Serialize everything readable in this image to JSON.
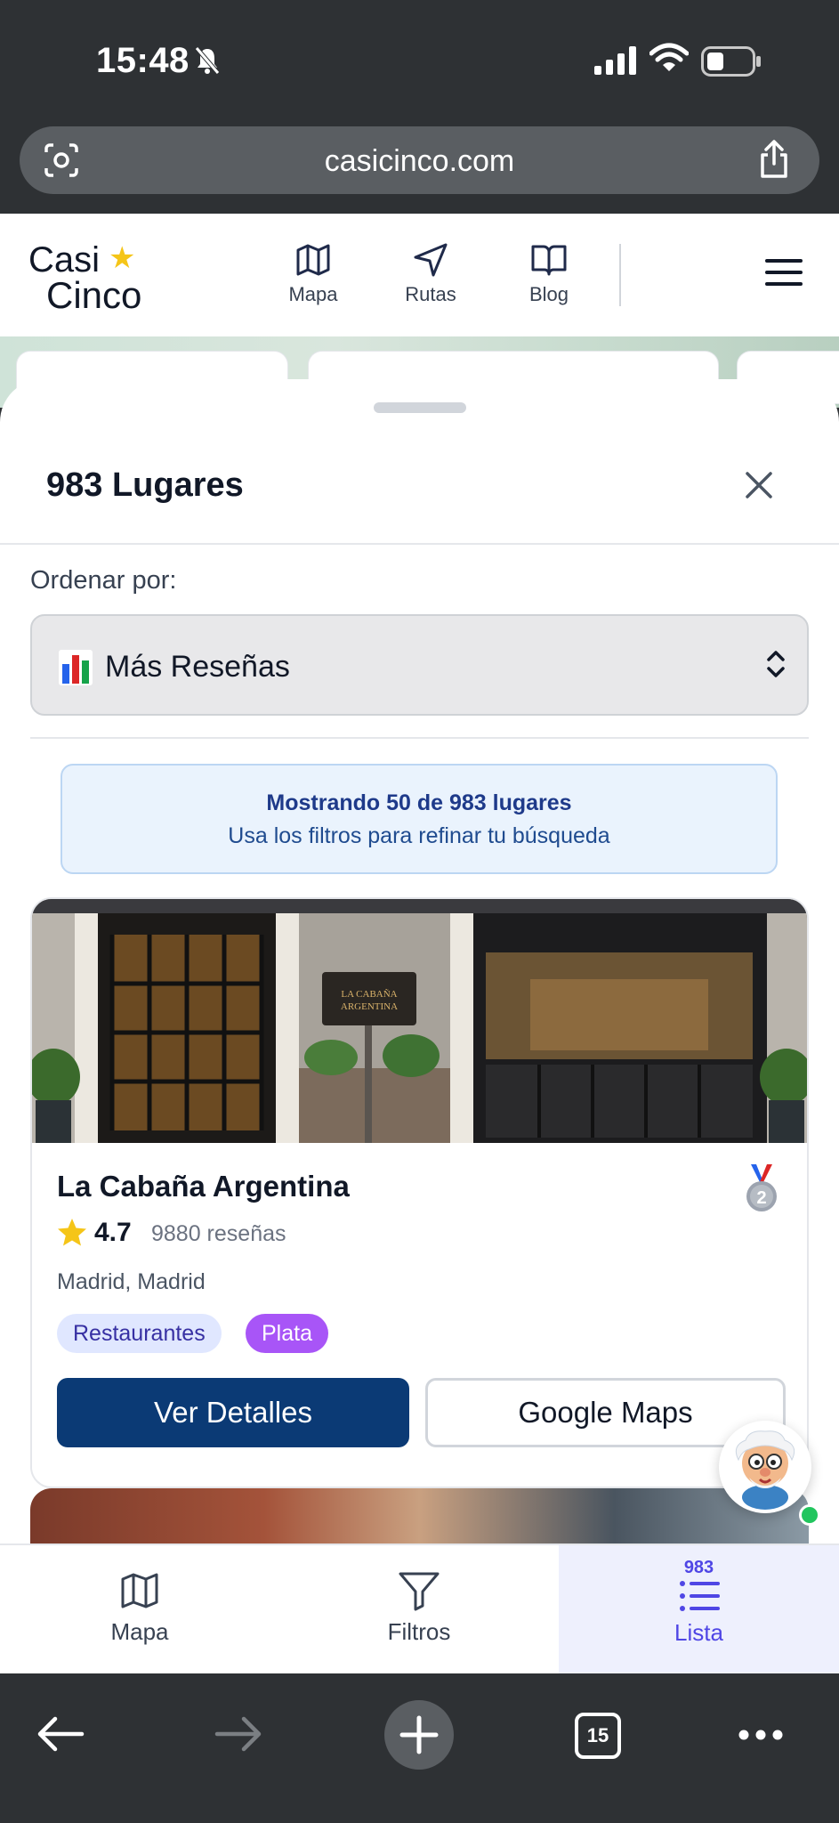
{
  "status_bar": {
    "time": "15:48"
  },
  "browser": {
    "url": "casicinco.com",
    "tab_count": "15"
  },
  "site": {
    "logo_line1": "Casi",
    "logo_line2": "Cinco",
    "nav": [
      {
        "label": "Mapa",
        "icon": "map-icon"
      },
      {
        "label": "Rutas",
        "icon": "navigation-icon"
      },
      {
        "label": "Blog",
        "icon": "book-icon"
      }
    ]
  },
  "sheet": {
    "title": "983 Lugares",
    "sort_label": "Ordenar por:",
    "sort_value": "Más Reseñas",
    "info_strong": "Mostrando 50 de 983 lugares",
    "info_sub": "Usa los filtros para refinar tu búsqueda"
  },
  "card": {
    "name": "La Cabaña Argentina",
    "rating": "4.7",
    "reviews": "9880 reseñas",
    "location": "Madrid, Madrid",
    "category": "Restaurantes",
    "level": "Plata",
    "medal_rank": "2",
    "details_label": "Ver Detalles",
    "maps_label": "Google Maps",
    "photo_sign": "LA CABAÑA ARGENTINA"
  },
  "tab_bar": {
    "map_label": "Mapa",
    "filters_label": "Filtros",
    "list_label": "Lista",
    "list_count": "983"
  },
  "colors": {
    "primary": "#0b3a75",
    "accent": "#4f46e5",
    "level_badge": "#a855f7",
    "star": "#f5c518"
  }
}
